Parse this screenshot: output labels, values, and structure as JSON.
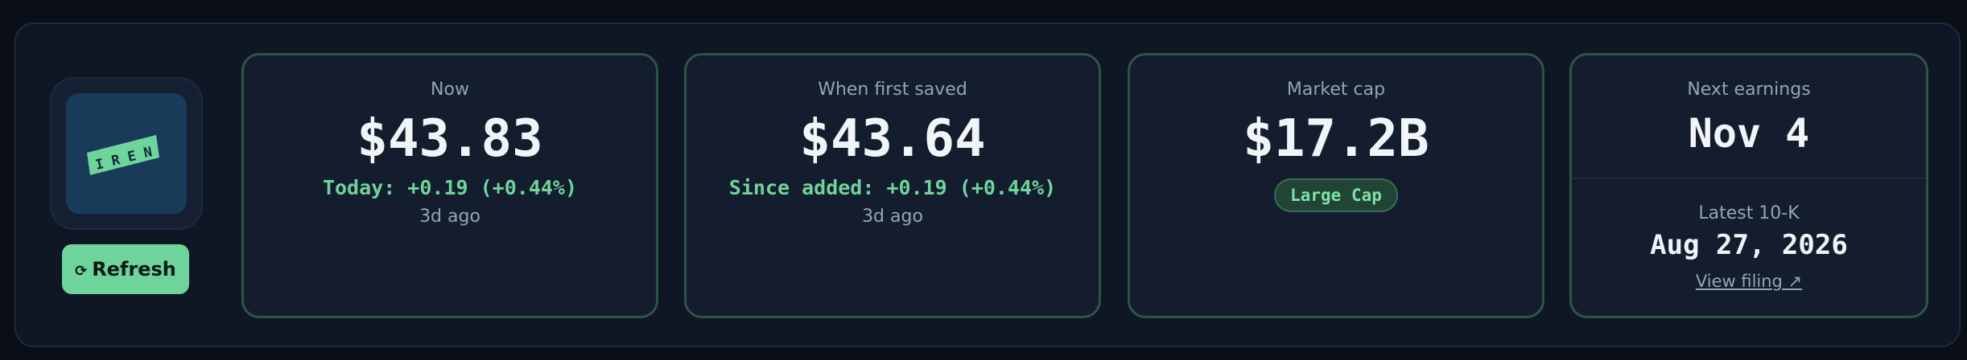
{
  "logo": {
    "text": "IREN",
    "icon": "iren-logo",
    "tile_color": "#1a3a5a",
    "mark_color": "#6fd39c"
  },
  "refresh": {
    "icon": "refresh-icon",
    "icon_glyph": "⟳",
    "label": "Refresh"
  },
  "now": {
    "label": "Now",
    "price": "$43.83",
    "change": "Today: +0.19 (+0.44%)",
    "updated": "3d ago"
  },
  "first_saved": {
    "label": "When first saved",
    "price": "$43.64",
    "change": "Since added: +0.19 (+0.44%)",
    "updated": "3d ago"
  },
  "market_cap": {
    "label": "Market cap",
    "value": "$17.2B",
    "badge": "Large Cap"
  },
  "earnings": {
    "next_label": "Next earnings",
    "next_date": "Nov 4",
    "filing_label": "Latest 10-K",
    "filing_date": "Aug 27, 2026",
    "filing_link": "View filing ↗"
  },
  "colors": {
    "accent": "#6fd39c",
    "card_border": "#2e5446",
    "background": "#0a0f17"
  }
}
